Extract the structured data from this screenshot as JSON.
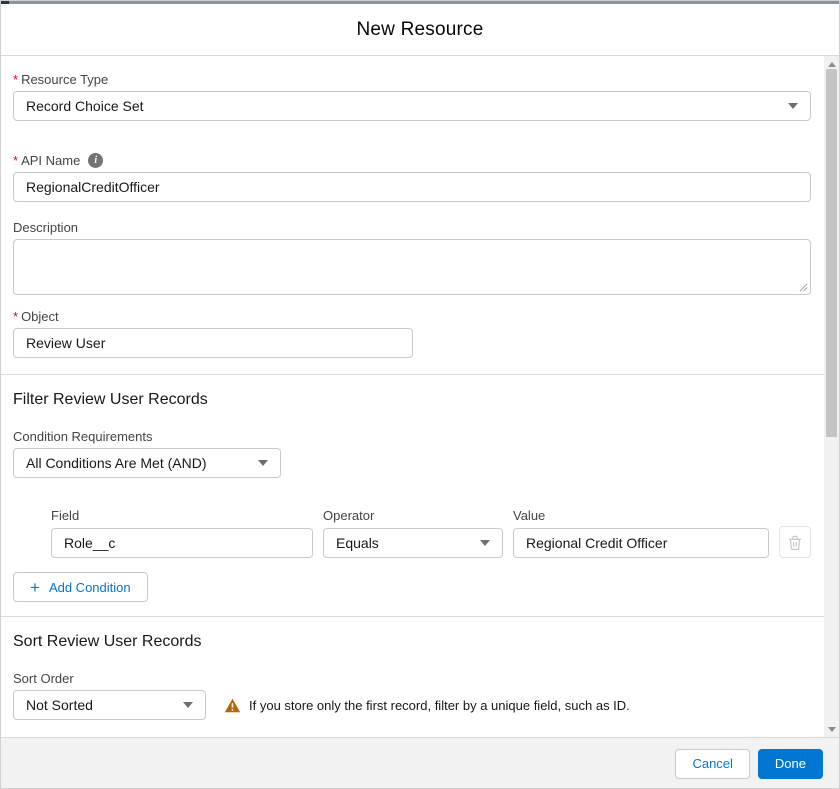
{
  "modal": {
    "title": "New Resource",
    "footer": {
      "cancel_label": "Cancel",
      "done_label": "Done"
    }
  },
  "form": {
    "required_marker": "*",
    "resource_type": {
      "label": "Resource Type",
      "value": "Record Choice Set"
    },
    "api_name": {
      "label": "API Name",
      "value": "RegionalCreditOfficer"
    },
    "description": {
      "label": "Description",
      "value": ""
    },
    "object": {
      "label": "Object",
      "value": "Review User"
    }
  },
  "filter_section": {
    "heading": "Filter Review User Records",
    "condition_requirements": {
      "label": "Condition Requirements",
      "value": "All Conditions Are Met (AND)"
    },
    "conditions": [
      {
        "field_label": "Field",
        "field_value": "Role__c",
        "operator_label": "Operator",
        "operator_value": "Equals",
        "value_label": "Value",
        "value_value": "Regional Credit Officer"
      }
    ],
    "add_condition_label": "Add Condition"
  },
  "sort_section": {
    "heading": "Sort Review User Records",
    "sort_order": {
      "label": "Sort Order",
      "value": "Not Sorted"
    },
    "warning_text": "If you store only the first record, filter by a unique field, such as ID."
  },
  "icons": {
    "info": "i",
    "plus": "+"
  },
  "colors": {
    "accent_blue": "#0176d3",
    "warning_orange": "#b7640a",
    "required_red": "#ea001e",
    "top_strip": "#8296a6"
  }
}
